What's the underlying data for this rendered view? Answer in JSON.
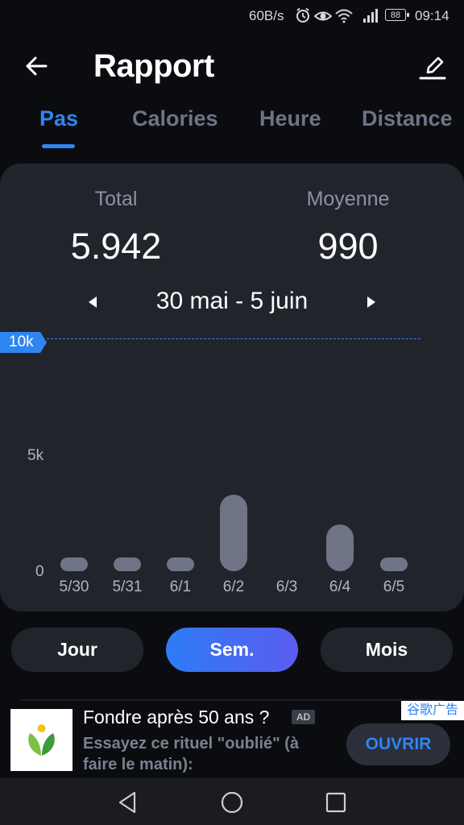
{
  "status_bar": {
    "speed": "60B/s",
    "battery": "88",
    "time": "09:14",
    "icons": [
      "alarm-icon",
      "eye-icon",
      "wifi-icon",
      "signal-icon",
      "battery-icon"
    ]
  },
  "header": {
    "title": "Rapport",
    "back_icon": "back-arrow-icon",
    "edit_icon": "edit-pencil-icon"
  },
  "tabs": [
    {
      "label": "Pas",
      "active": true
    },
    {
      "label": "Calories",
      "active": false
    },
    {
      "label": "Heure",
      "active": false
    },
    {
      "label": "Distance",
      "active": false
    }
  ],
  "summary": {
    "total_label": "Total",
    "total_value": "5.942",
    "average_label": "Moyenne",
    "average_value": "990",
    "date_range": "30 mai - 5 juin",
    "prev_icon": "caret-left-icon",
    "next_icon": "caret-right-icon"
  },
  "chart_data": {
    "type": "bar",
    "categories": [
      "5/30",
      "5/31",
      "6/1",
      "6/2",
      "6/3",
      "6/4",
      "6/5"
    ],
    "values": [
      300,
      300,
      300,
      3300,
      0,
      2000,
      300
    ],
    "ylim": [
      0,
      10000
    ],
    "yticks": [
      "0",
      "5k",
      "10k"
    ],
    "goal_label": "10k",
    "goal_value": 10000,
    "accent": "#2e86f2",
    "bar_color": "#6f7587"
  },
  "period": {
    "day": "Jour",
    "week": "Sem.",
    "month": "Mois",
    "selected": "Sem."
  },
  "ad": {
    "title": "Fondre après 50 ans ?",
    "badge": "AD",
    "description": "Essayez ce rituel \"oublié\" (à faire le matin):",
    "cta": "OUVRIR",
    "network": "谷歌广告"
  },
  "nav": {
    "back_icon": "nav-back-icon",
    "home_icon": "nav-home-icon",
    "recents_icon": "nav-recents-icon"
  }
}
